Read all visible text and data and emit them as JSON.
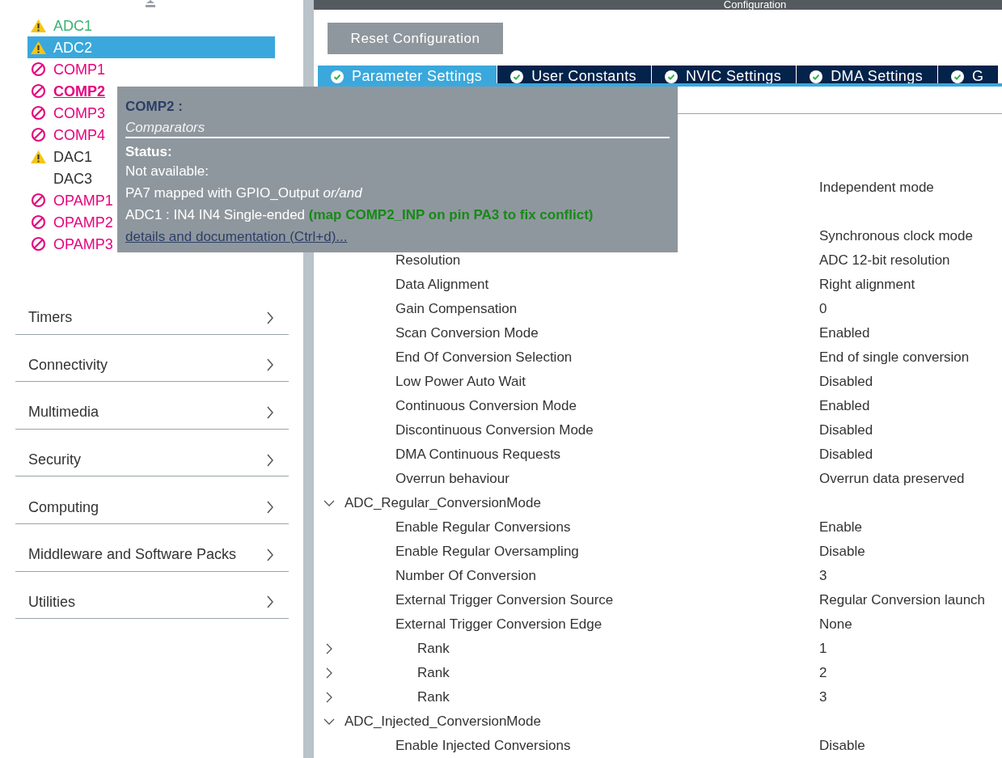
{
  "peripherals": [
    {
      "label": "ADC1",
      "kind": "warning",
      "selected": false,
      "hovered": false
    },
    {
      "label": "ADC2",
      "kind": "warning",
      "selected": true,
      "hovered": false
    },
    {
      "label": "COMP1",
      "kind": "unavailable",
      "selected": false,
      "hovered": false
    },
    {
      "label": "COMP2",
      "kind": "unavailable",
      "selected": false,
      "hovered": true
    },
    {
      "label": "COMP3",
      "kind": "unavailable",
      "selected": false,
      "hovered": false
    },
    {
      "label": "COMP4",
      "kind": "unavailable",
      "selected": false,
      "hovered": false
    },
    {
      "label": "DAC1",
      "kind": "warning",
      "selected": false,
      "hovered": false
    },
    {
      "label": "DAC3",
      "kind": "none",
      "selected": false,
      "hovered": false
    },
    {
      "label": "OPAMP1",
      "kind": "unavailable",
      "selected": false,
      "hovered": false
    },
    {
      "label": "OPAMP2",
      "kind": "unavailable",
      "selected": false,
      "hovered": false
    },
    {
      "label": "OPAMP3",
      "kind": "unavailable",
      "selected": false,
      "hovered": false
    }
  ],
  "categories": [
    "Timers",
    "Connectivity",
    "Multimedia",
    "Security",
    "Computing",
    "Middleware and Software Packs",
    "Utilities"
  ],
  "configuration": {
    "title": "Configuration",
    "reset_button": "Reset Configuration",
    "tabs": [
      {
        "label": "Parameter Settings",
        "selected": true
      },
      {
        "label": "User Constants",
        "selected": false
      },
      {
        "label": "NVIC Settings",
        "selected": false
      },
      {
        "label": "DMA Settings",
        "selected": false
      },
      {
        "label": "G",
        "selected": false
      }
    ],
    "parameters": [
      {
        "kind": "param",
        "value": "Independent mode"
      },
      {
        "kind": "group",
        "children": [
          {
            "kind": "param",
            "value": "Synchronous clock mode"
          },
          {
            "kind": "param",
            "label": "Resolution",
            "value": "ADC 12-bit resolution"
          },
          {
            "kind": "param",
            "label": "Data Alignment",
            "value": "Right alignment"
          },
          {
            "kind": "param",
            "label": "Gain Compensation",
            "value": "0"
          },
          {
            "kind": "param",
            "label": "Scan Conversion Mode",
            "value": "Enabled"
          },
          {
            "kind": "param",
            "label": "End Of Conversion Selection",
            "value": "End of single conversion"
          },
          {
            "kind": "param",
            "label": "Low Power Auto Wait",
            "value": "Disabled"
          },
          {
            "kind": "param",
            "label": "Continuous Conversion Mode",
            "value": "Enabled"
          },
          {
            "kind": "param",
            "label": "Discontinuous Conversion Mode",
            "value": "Disabled"
          },
          {
            "kind": "param",
            "label": "DMA Continuous Requests",
            "value": "Disabled"
          },
          {
            "kind": "param",
            "label": "Overrun behaviour",
            "value": "Overrun data preserved"
          }
        ]
      },
      {
        "kind": "group",
        "label": "ADC_Regular_ConversionMode",
        "expanded": true,
        "children": [
          {
            "kind": "param",
            "label": "Enable Regular Conversions",
            "value": "Enable"
          },
          {
            "kind": "param",
            "label": "Enable Regular Oversampling",
            "value": "Disable"
          },
          {
            "kind": "param",
            "label": "Number Of Conversion",
            "value": "3"
          },
          {
            "kind": "param",
            "label": "External Trigger Conversion Source",
            "value": "Regular Conversion launch"
          },
          {
            "kind": "param",
            "label": "External Trigger Conversion Edge",
            "value": "None"
          },
          {
            "kind": "rank",
            "label": "Rank",
            "value": "1",
            "expanded": false
          },
          {
            "kind": "rank",
            "label": "Rank",
            "value": "2",
            "expanded": false
          },
          {
            "kind": "rank",
            "label": "Rank",
            "value": "3",
            "expanded": false
          }
        ]
      },
      {
        "kind": "group",
        "label": "ADC_Injected_ConversionMode",
        "expanded": true,
        "children": [
          {
            "kind": "param",
            "label": "Enable Injected Conversions",
            "value": "Disable"
          }
        ]
      }
    ]
  },
  "tooltip": {
    "title": "COMP2 :",
    "subtitle": "Comparators",
    "status_heading": "Status:",
    "lines": [
      "Not available:",
      "PA7 mapped with GPIO_Output *or/and*",
      "ADC1 : IN4 IN4 Single-ended **(map COMP2_INP on pin PA3 to fix conflict)**"
    ],
    "link": "details and documentation (Ctrl+d)..."
  }
}
